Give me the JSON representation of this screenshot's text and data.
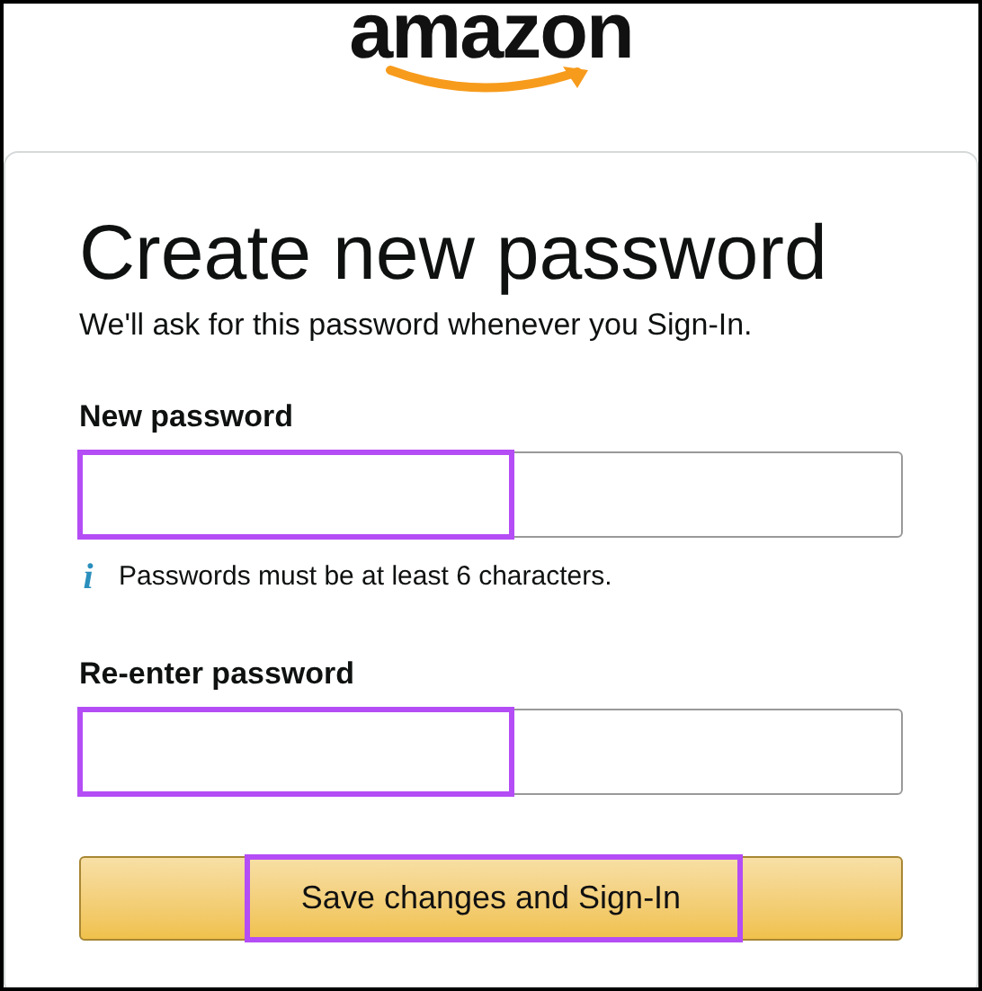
{
  "logo": {
    "text": "amazon"
  },
  "title": "Create new password",
  "subtitle": "We'll ask for this password whenever you Sign-In.",
  "fields": [
    {
      "label": "New password",
      "highlighted": true,
      "hint": {
        "icon": "i",
        "text": "Passwords must be at least 6 characters."
      }
    },
    {
      "label": "Re-enter password",
      "highlighted": true
    }
  ],
  "submit": {
    "label": "Save changes and Sign-In",
    "highlighted": true
  }
}
